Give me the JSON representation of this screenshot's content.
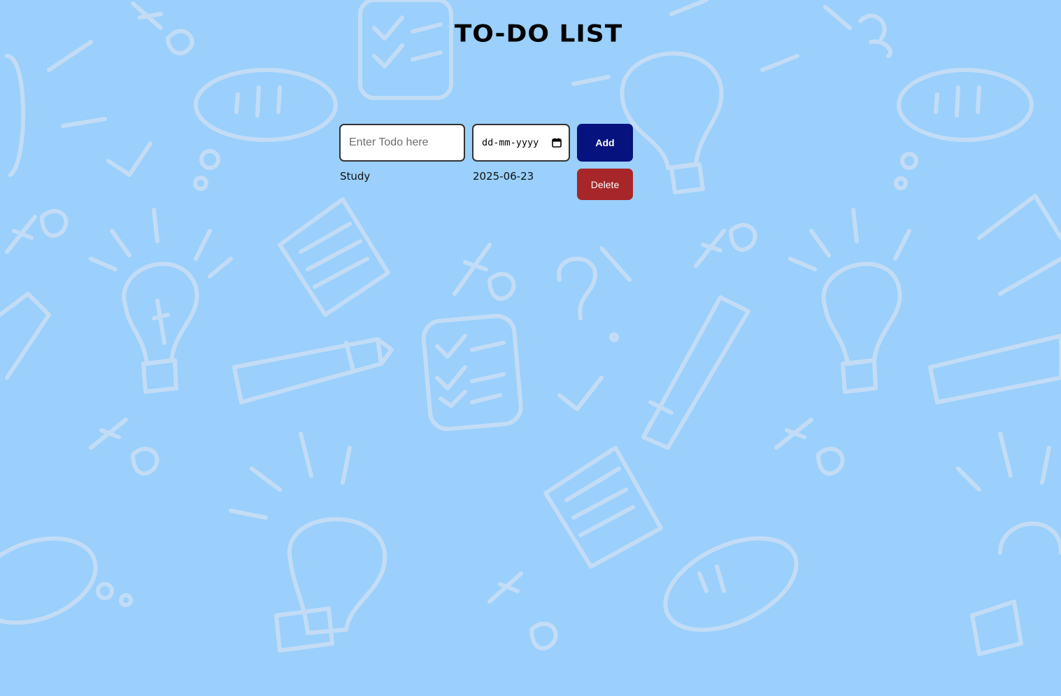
{
  "header": {
    "title": "To-Do List"
  },
  "form": {
    "todo_placeholder": "Enter Todo here",
    "todo_value": "",
    "date_placeholder": "dd-mm-yyyy",
    "add_label": "Add"
  },
  "todos": [
    {
      "name": "Study",
      "date": "2025-06-23",
      "delete_label": "Delete"
    }
  ],
  "icons": {
    "date_picker": "calendar-icon"
  },
  "colors": {
    "background": "#9ad0fb",
    "doodle": "#c8def6",
    "add_button": "#06127e",
    "delete_button": "#a72629"
  }
}
